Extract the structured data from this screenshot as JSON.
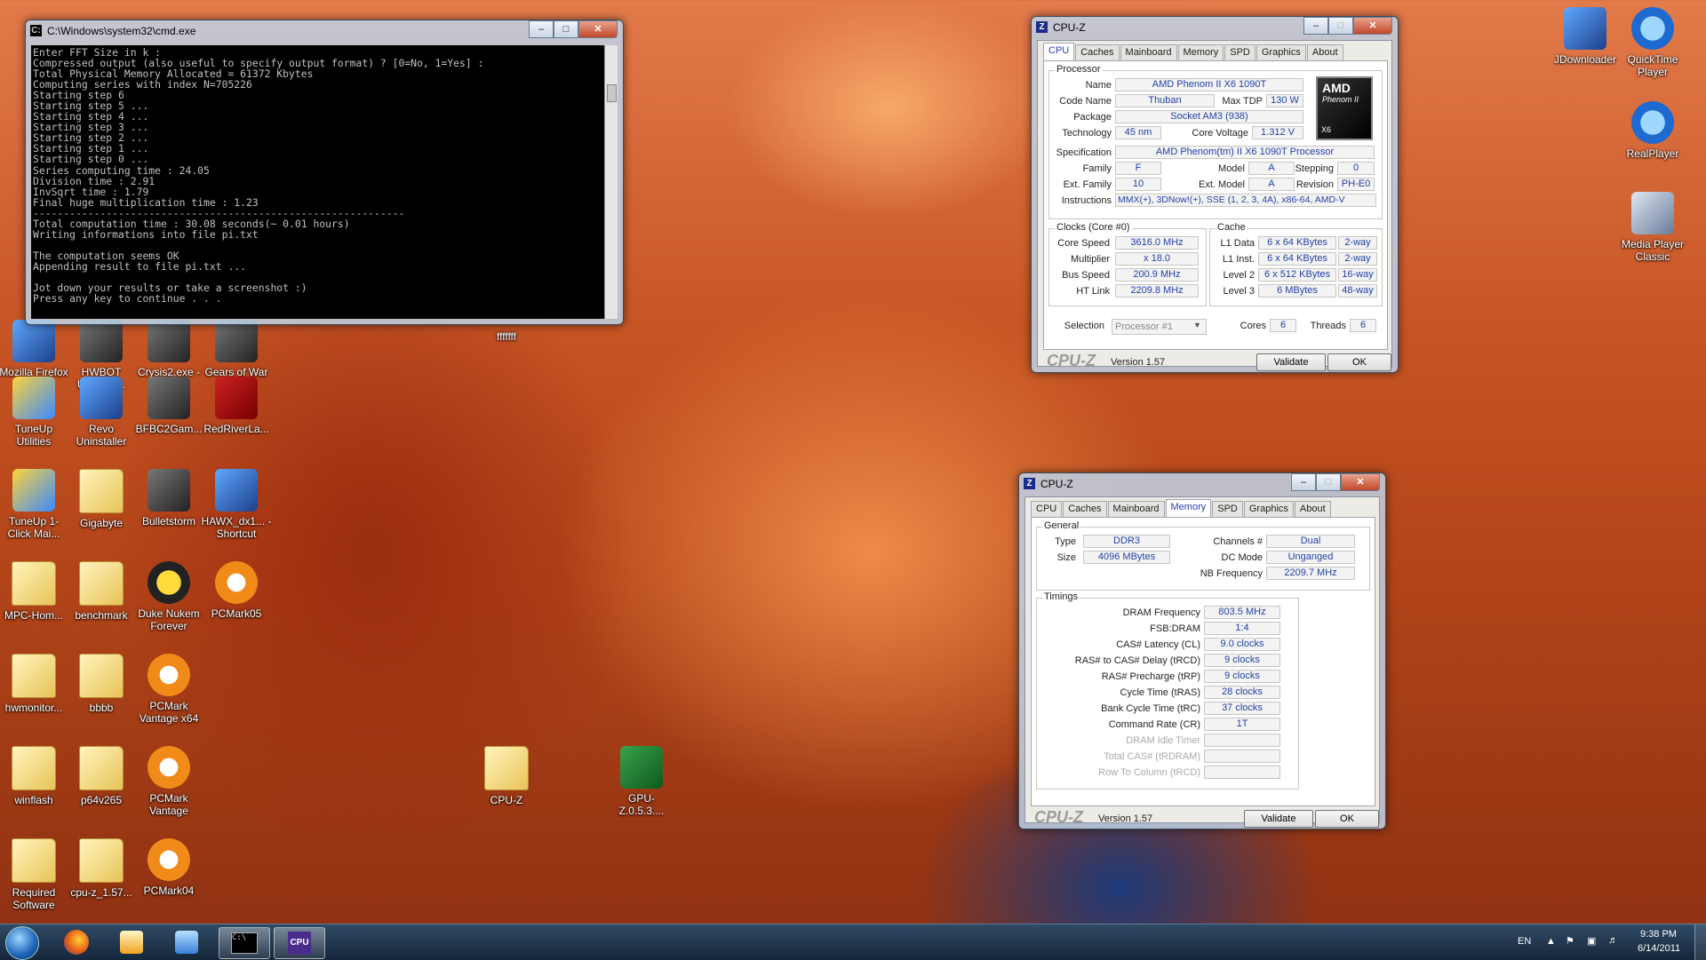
{
  "desktop": {
    "icons": [
      {
        "label": "Mozilla Firefox",
        "type": "app"
      },
      {
        "label": "HWBOT Unigine ...",
        "type": "game"
      },
      {
        "label": "Crysis2.exe - Shortcut",
        "type": "game"
      },
      {
        "label": "Gears of War",
        "type": "game"
      },
      {
        "label": "TuneUp Utilities",
        "type": "tune"
      },
      {
        "label": "Revo Uninstaller",
        "type": "app"
      },
      {
        "label": "BFBC2Gam...",
        "type": "game"
      },
      {
        "label": "RedRiverLa...",
        "type": "red"
      },
      {
        "label": "TuneUp 1-Click Mai...",
        "type": "tune"
      },
      {
        "label": "Gigabyte",
        "type": "folder"
      },
      {
        "label": "Bulletstorm",
        "type": "game"
      },
      {
        "label": "HAWX_dx1... - Shortcut",
        "type": "app"
      },
      {
        "label": "MPC-Hom...",
        "type": "folder"
      },
      {
        "label": "benchmark",
        "type": "folder"
      },
      {
        "label": "Duke Nukem Forever",
        "type": "nuke"
      },
      {
        "label": "PCMark05",
        "type": "pcmark"
      },
      {
        "label": "hwmonitor...",
        "type": "folder"
      },
      {
        "label": "bbbb",
        "type": "folder"
      },
      {
        "label": "PCMark Vantage x64",
        "type": "pcmark"
      },
      {
        "label": "winflash",
        "type": "folder"
      },
      {
        "label": "p64v265",
        "type": "folder"
      },
      {
        "label": "PCMark Vantage",
        "type": "pcmark"
      },
      {
        "label": "Required Software",
        "type": "folder"
      },
      {
        "label": "cpu-z_1.57...",
        "type": "folder"
      },
      {
        "label": "PCMark04",
        "type": "pcmark"
      },
      {
        "label": "fffffff",
        "type": "none"
      },
      {
        "label": "CPU-Z",
        "type": "folder"
      },
      {
        "label": "GPU-Z.0.5.3....",
        "type": "gpu"
      },
      {
        "label": "JDownloader",
        "type": "app"
      },
      {
        "label": "QuickTime Player",
        "type": "qt"
      },
      {
        "label": "RealPlayer",
        "type": "qt"
      },
      {
        "label": "Media Player Classic",
        "type": "mpc"
      }
    ]
  },
  "cmd": {
    "title": "C:\\Windows\\system32\\cmd.exe",
    "lines": [
      "Enter FFT Size in k :",
      "Compressed output (also useful to specify output format) ? [0=No, 1=Yes] :",
      "Total Physical Memory Allocated = 61372 Kbytes",
      "Computing series with index N=705226",
      "Starting step 6",
      "Starting step 5 ...",
      "Starting step 4 ...",
      "Starting step 3 ...",
      "Starting step 2 ...",
      "Starting step 1 ...",
      "Starting step 0 ...",
      "Series computing time : 24.05",
      "Division time : 2.91",
      "InvSqrt time : 1.79",
      "Final huge multiplication time : 1.23",
      "-------------------------------------------------------------",
      "Total computation time : 30.08 seconds(~ 0.01 hours)",
      "Writing informations into file pi.txt",
      "",
      "The computation seems OK",
      "Appending result to file pi.txt ...",
      "",
      "Jot down your results or take a screenshot :)",
      "Press any key to continue . . ."
    ]
  },
  "cpuz1": {
    "title": "CPU-Z",
    "tabs": [
      "CPU",
      "Caches",
      "Mainboard",
      "Memory",
      "SPD",
      "Graphics",
      "About"
    ],
    "active_tab": "CPU",
    "processor": {
      "group": "Processor",
      "name_label": "Name",
      "name": "AMD Phenom II X6 1090T",
      "codename_label": "Code Name",
      "codename": "Thuban",
      "maxtdp_label": "Max TDP",
      "maxtdp": "130 W",
      "package_label": "Package",
      "package": "Socket AM3 (938)",
      "technology_label": "Technology",
      "technology": "45 nm",
      "corevoltage_label": "Core Voltage",
      "corevoltage": "1.312 V",
      "spec_label": "Specification",
      "spec": "AMD Phenom(tm) II X6 1090T Processor",
      "family_label": "Family",
      "family": "F",
      "model_label": "Model",
      "model": "A",
      "stepping_label": "Stepping",
      "stepping": "0",
      "extfamily_label": "Ext. Family",
      "extfamily": "10",
      "extmodel_label": "Ext. Model",
      "extmodel": "A",
      "revision_label": "Revision",
      "revision": "PH-E0",
      "instructions_label": "Instructions",
      "instructions": "MMX(+), 3DNow!(+), SSE (1, 2, 3, 4A), x86-64, AMD-V",
      "logo_brand": "AMD",
      "logo_line": "Phenom II",
      "logo_sub": "X6"
    },
    "clocks": {
      "group": "Clocks (Core #0)",
      "corespeed_label": "Core Speed",
      "corespeed": "3616.0 MHz",
      "multiplier_label": "Multiplier",
      "multiplier": "x 18.0",
      "busspeed_label": "Bus Speed",
      "busspeed": "200.9 MHz",
      "htlink_label": "HT Link",
      "htlink": "2209.8 MHz"
    },
    "cache": {
      "group": "Cache",
      "rows": [
        {
          "label": "L1 Data",
          "size": "6 x 64 KBytes",
          "way": "2-way"
        },
        {
          "label": "L1 Inst.",
          "size": "6 x 64 KBytes",
          "way": "2-way"
        },
        {
          "label": "Level 2",
          "size": "6 x 512 KBytes",
          "way": "16-way"
        },
        {
          "label": "Level 3",
          "size": "6 MBytes",
          "way": "48-way"
        }
      ]
    },
    "selection_label": "Selection",
    "selection": "Processor #1",
    "cores_label": "Cores",
    "cores": "6",
    "threads_label": "Threads",
    "threads": "6",
    "logo": "CPU-Z",
    "version": "Version 1.57",
    "validate": "Validate",
    "ok": "OK"
  },
  "cpuz2": {
    "title": "CPU-Z",
    "tabs": [
      "CPU",
      "Caches",
      "Mainboard",
      "Memory",
      "SPD",
      "Graphics",
      "About"
    ],
    "active_tab": "Memory",
    "general": {
      "group": "General",
      "type_label": "Type",
      "type": "DDR3",
      "size_label": "Size",
      "size": "4096 MBytes",
      "channels_label": "Channels #",
      "channels": "Dual",
      "dcmode_label": "DC Mode",
      "dcmode": "Unganged",
      "nbfreq_label": "NB Frequency",
      "nbfreq": "2209.7 MHz"
    },
    "timings": {
      "group": "Timings",
      "rows": [
        {
          "label": "DRAM Frequency",
          "value": "803.5 MHz",
          "dim": false
        },
        {
          "label": "FSB:DRAM",
          "value": "1:4",
          "dim": false
        },
        {
          "label": "CAS# Latency (CL)",
          "value": "9.0 clocks",
          "dim": false
        },
        {
          "label": "RAS# to CAS# Delay (tRCD)",
          "value": "9 clocks",
          "dim": false
        },
        {
          "label": "RAS# Precharge (tRP)",
          "value": "9 clocks",
          "dim": false
        },
        {
          "label": "Cycle Time (tRAS)",
          "value": "28 clocks",
          "dim": false
        },
        {
          "label": "Bank Cycle Time (tRC)",
          "value": "37 clocks",
          "dim": false
        },
        {
          "label": "Command Rate (CR)",
          "value": "1T",
          "dim": false
        },
        {
          "label": "DRAM Idle Timer",
          "value": "",
          "dim": true
        },
        {
          "label": "Total CAS# (tRDRAM)",
          "value": "",
          "dim": true
        },
        {
          "label": "Row To Column (tRCD)",
          "value": "",
          "dim": true
        }
      ]
    },
    "logo": "CPU-Z",
    "version": "Version 1.57",
    "validate": "Validate",
    "ok": "OK"
  },
  "taskbar": {
    "lang": "EN",
    "time": "9:38 PM",
    "date": "6/14/2011",
    "items": [
      "start",
      "firefox",
      "media",
      "network",
      "cmd",
      "cpuz"
    ],
    "active": [
      "cmd",
      "cpuz"
    ]
  }
}
